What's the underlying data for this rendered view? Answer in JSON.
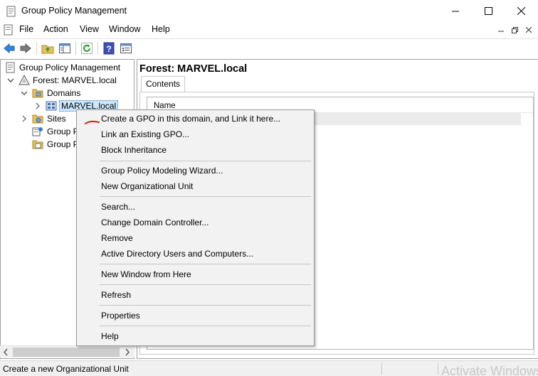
{
  "window": {
    "title": "Group Policy Management"
  },
  "menubar": {
    "items": [
      "File",
      "Action",
      "View",
      "Window",
      "Help"
    ]
  },
  "toolbar": {
    "icons": [
      "back-icon",
      "forward-icon",
      "up-folder-icon",
      "show-tree-icon",
      "refresh-icon",
      "help-icon",
      "properties-icon"
    ]
  },
  "tree": {
    "root": "Group Policy Management",
    "forest": "Forest: MARVEL.local",
    "domains": "Domains",
    "domain": "MARVEL.local",
    "sites": "Sites",
    "item4": "Group P",
    "item5": "Group P"
  },
  "right": {
    "title": "Forest: MARVEL.local",
    "tab": "Contents",
    "column_name": "Name"
  },
  "context_menu": {
    "items": [
      "Create a GPO in this domain, and Link it here...",
      "Link an Existing GPO...",
      "Block Inheritance",
      "Group Policy Modeling Wizard...",
      "New Organizational Unit",
      "Search...",
      "Change Domain Controller...",
      "Remove",
      "Active Directory Users and Computers...",
      "New Window from Here",
      "Refresh",
      "Properties",
      "Help"
    ]
  },
  "status": {
    "text": "Create a new Organizational Unit",
    "watermark": "Activate Windows"
  }
}
